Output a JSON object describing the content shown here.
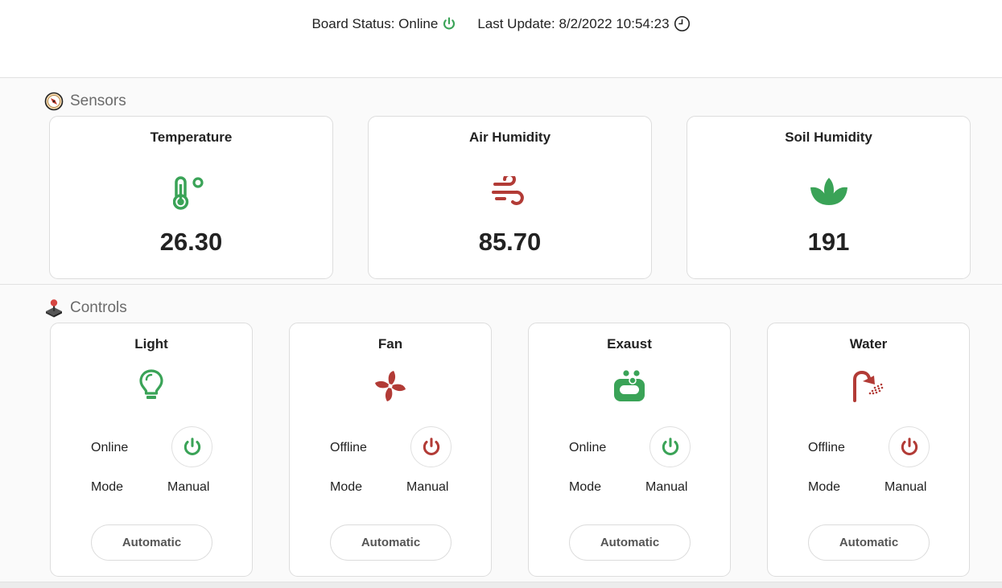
{
  "header": {
    "board_status_label": "Board Status: Online",
    "last_update_label": "Last Update: 8/2/2022 10:54:23"
  },
  "sensors": {
    "title": "Sensors",
    "cards": [
      {
        "title": "Temperature",
        "value": "26.30",
        "icon": "thermometer-celsius-icon",
        "color": "#3aa357"
      },
      {
        "title": "Air Humidity",
        "value": "85.70",
        "icon": "wind-icon",
        "color": "#b23b36"
      },
      {
        "title": "Soil Humidity",
        "value": "191",
        "icon": "leaf-icon",
        "color": "#3aa357"
      }
    ]
  },
  "controls": {
    "title": "Controls",
    "cards": [
      {
        "title": "Light",
        "state": "Online",
        "mode_label": "Mode",
        "mode": "Manual",
        "auto_label": "Automatic",
        "icon": "lightbulb-icon",
        "color": "#3aa357"
      },
      {
        "title": "Fan",
        "state": "Offline",
        "mode_label": "Mode",
        "mode": "Manual",
        "auto_label": "Automatic",
        "icon": "fan-icon",
        "color": "#b23b36"
      },
      {
        "title": "Exaust",
        "state": "Online",
        "mode_label": "Mode",
        "mode": "Manual",
        "auto_label": "Automatic",
        "icon": "soap-icon",
        "color": "#3aa357"
      },
      {
        "title": "Water",
        "state": "Offline",
        "mode_label": "Mode",
        "mode": "Manual",
        "auto_label": "Automatic",
        "icon": "shower-icon",
        "color": "#b23b36"
      }
    ]
  },
  "colors": {
    "online": "#3aa357",
    "offline": "#b23b36",
    "section_title": "#6b6b6b"
  }
}
